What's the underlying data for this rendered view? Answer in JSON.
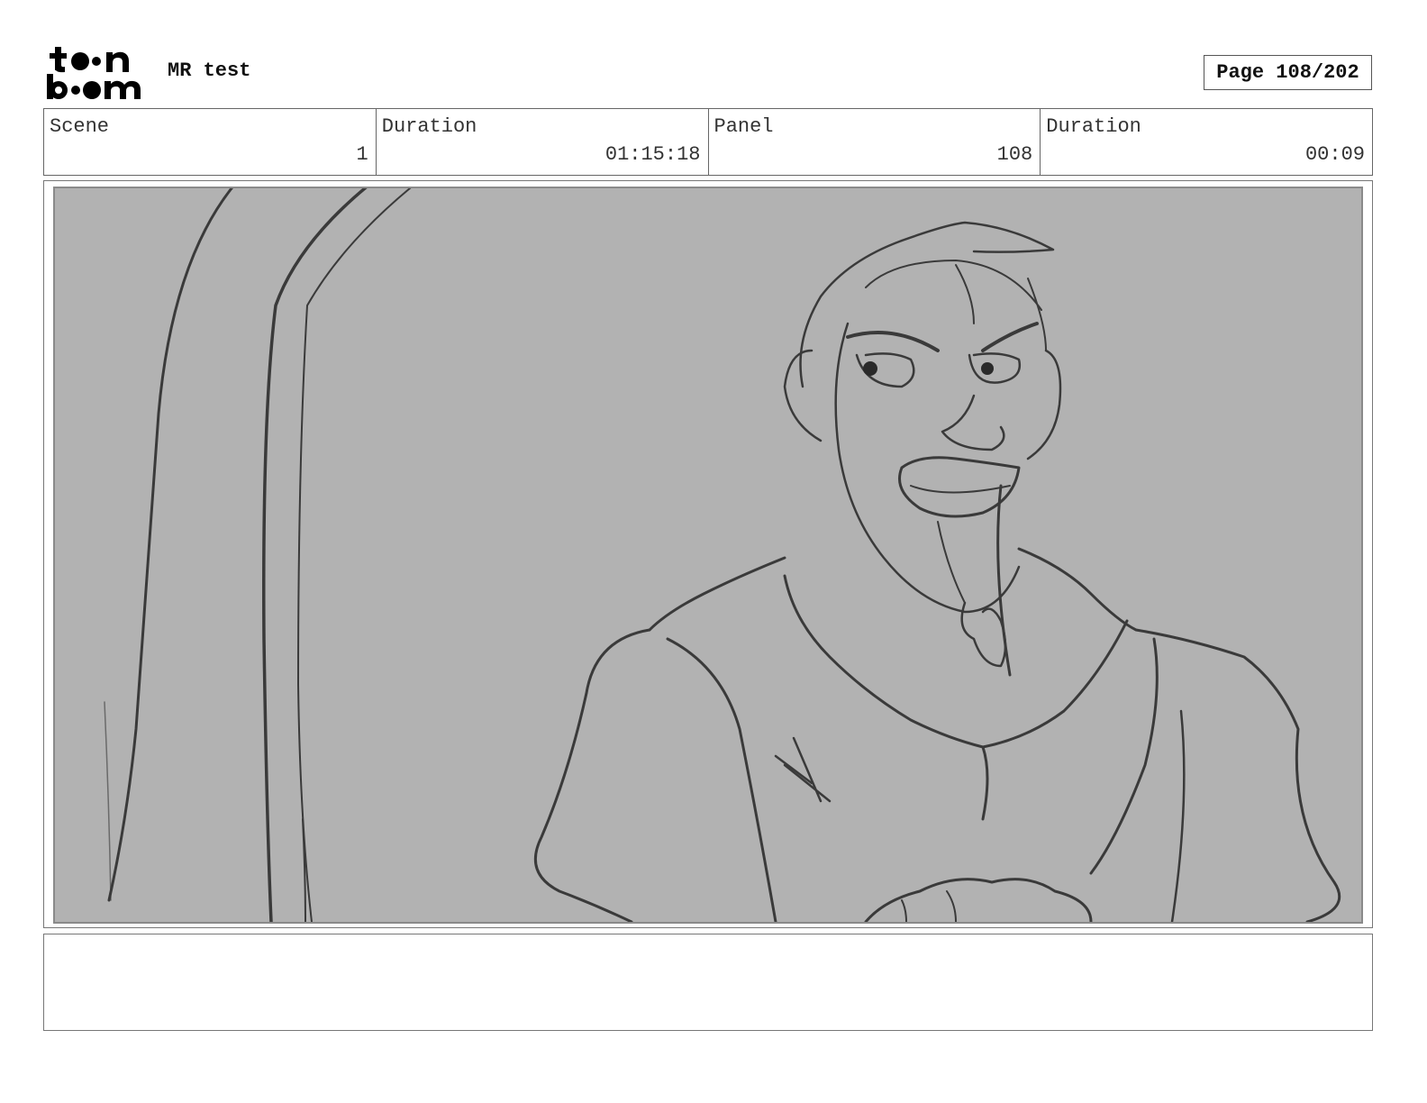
{
  "header": {
    "logo_text": [
      "toon",
      "boom"
    ],
    "project_title": "MR test",
    "page_label": "Page 108/202"
  },
  "info": {
    "scene_label": "Scene",
    "scene_value": "1",
    "scene_duration_label": "Duration",
    "scene_duration_value": "01:15:18",
    "panel_label": "Panel",
    "panel_value": "108",
    "panel_duration_label": "Duration",
    "panel_duration_value": "00:09"
  },
  "panel": {
    "background_color": "#b2b2b2",
    "sketch_color": "#3a3a3a"
  },
  "notes": {
    "text": ""
  }
}
